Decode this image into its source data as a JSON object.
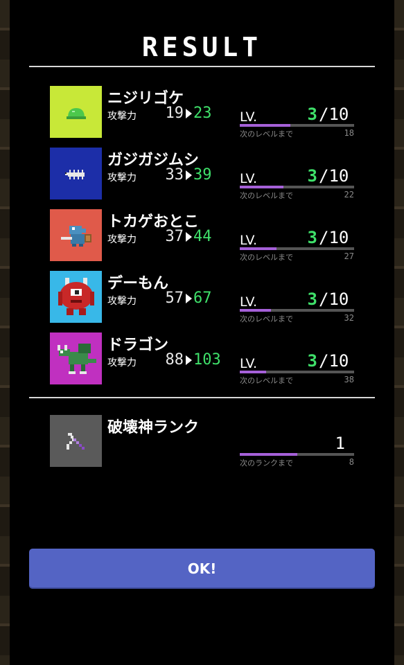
{
  "title": "RESULT",
  "monsters": [
    {
      "name": "ニジリゴケ",
      "atk_label": "攻撃力",
      "atk_old": "19",
      "atk_new": "23",
      "lv_label": "LV.",
      "level": "3",
      "max_level": "/10",
      "next_label": "次のレベルまで",
      "next_value": "18",
      "progress": 0.44,
      "portrait_bg": "#c8e838",
      "icon": "slime-icon"
    },
    {
      "name": "ガジガジムシ",
      "atk_label": "攻撃力",
      "atk_old": "33",
      "atk_new": "39",
      "lv_label": "LV.",
      "level": "3",
      "max_level": "/10",
      "next_label": "次のレベルまで",
      "next_value": "22",
      "progress": 0.38,
      "portrait_bg": "#1c2ea8",
      "icon": "bug-icon"
    },
    {
      "name": "トカゲおとこ",
      "atk_label": "攻撃力",
      "atk_old": "37",
      "atk_new": "44",
      "lv_label": "LV.",
      "level": "3",
      "max_level": "/10",
      "next_label": "次のレベルまで",
      "next_value": "27",
      "progress": 0.32,
      "portrait_bg": "#e05a4a",
      "icon": "lizardman-icon"
    },
    {
      "name": "デーもん",
      "atk_label": "攻撃力",
      "atk_old": "57",
      "atk_new": "67",
      "lv_label": "LV.",
      "level": "3",
      "max_level": "/10",
      "next_label": "次のレベルまで",
      "next_value": "32",
      "progress": 0.27,
      "portrait_bg": "#38b8e8",
      "icon": "demon-icon"
    },
    {
      "name": "ドラゴン",
      "atk_label": "攻撃力",
      "atk_old": "88",
      "atk_new": "103",
      "lv_label": "LV.",
      "level": "3",
      "max_level": "/10",
      "next_label": "次のレベルまで",
      "next_value": "38",
      "progress": 0.23,
      "portrait_bg": "#c030c0",
      "icon": "dragon-icon"
    }
  ],
  "rank": {
    "name": "破壊神ランク",
    "value": "1",
    "next_label": "次のランクまで",
    "next_value": "8",
    "progress": 0.5,
    "portrait_bg": "#5a5a5a",
    "icon": "pickaxe-icon"
  },
  "ok_label": "OK!",
  "colors": {
    "green": "#3fe06a",
    "purple_bar": "#a560d8",
    "button": "#5464c4"
  }
}
